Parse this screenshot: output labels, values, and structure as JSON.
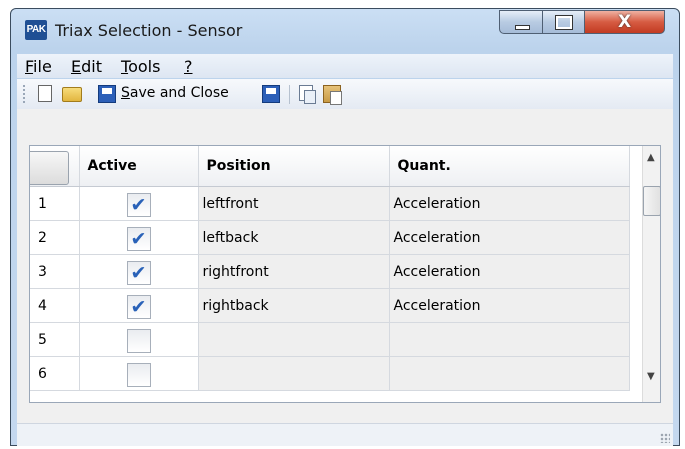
{
  "window": {
    "title": "Triax Selection - Sensor",
    "app_icon_text": "PAK",
    "close_glyph": "X"
  },
  "menu": {
    "file": {
      "accel": "F",
      "rest": "ile"
    },
    "edit": {
      "accel": "E",
      "rest": "dit"
    },
    "tools": {
      "accel": "T",
      "rest": "ools"
    },
    "help": {
      "accel": "?",
      "rest": ""
    }
  },
  "toolbar": {
    "save_close": {
      "accel": "S",
      "rest": "ave and Close"
    }
  },
  "grid": {
    "columns": [
      "Active",
      "Position",
      "Quant."
    ],
    "rows": [
      {
        "num": "1",
        "active": true,
        "position": "leftfront",
        "quant": "Acceleration"
      },
      {
        "num": "2",
        "active": true,
        "position": "leftback",
        "quant": "Acceleration"
      },
      {
        "num": "3",
        "active": true,
        "position": "rightfront",
        "quant": "Acceleration"
      },
      {
        "num": "4",
        "active": true,
        "position": "rightback",
        "quant": "Acceleration"
      },
      {
        "num": "5",
        "active": false,
        "position": "",
        "quant": ""
      },
      {
        "num": "6",
        "active": false,
        "position": "",
        "quant": ""
      }
    ]
  },
  "scrollbar": {
    "up_glyph": "▲",
    "down_glyph": "▼"
  }
}
